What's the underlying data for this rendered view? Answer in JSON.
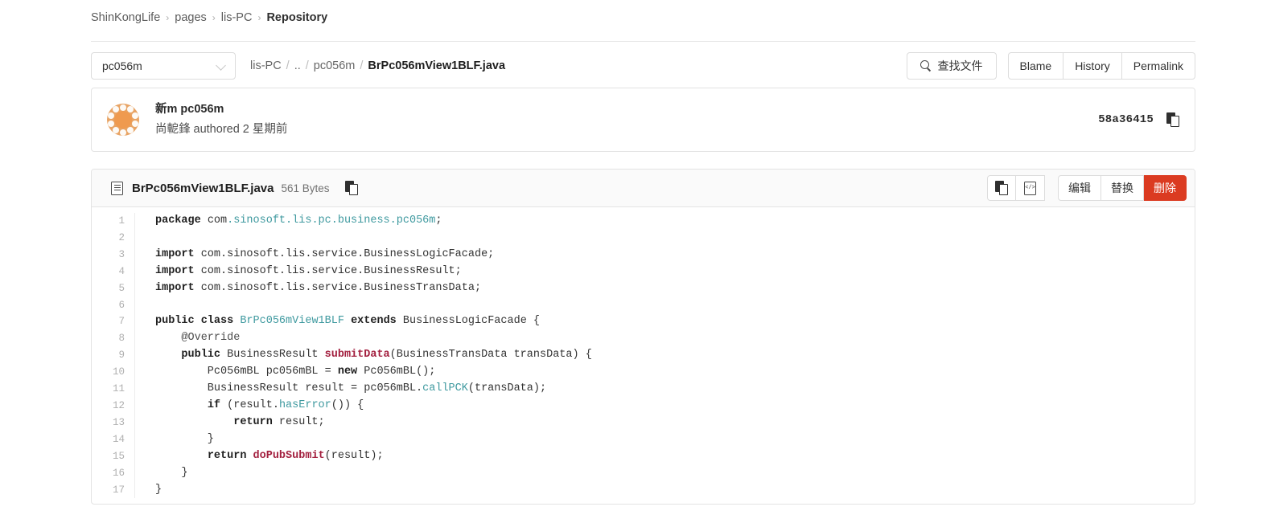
{
  "breadcrumb": {
    "items": [
      {
        "label": "ShinKongLife",
        "current": false
      },
      {
        "label": "pages",
        "current": false
      },
      {
        "label": "lis-PC",
        "current": false
      },
      {
        "label": "Repository",
        "current": true
      }
    ],
    "separator": "›"
  },
  "toolbar": {
    "branch_selected": "pc056m",
    "path": [
      {
        "label": "lis-PC",
        "type": "dir"
      },
      {
        "label": "..",
        "type": "dir"
      },
      {
        "label": "pc056m",
        "type": "dir"
      },
      {
        "label": "BrPc056mView1BLF.java",
        "type": "file"
      }
    ],
    "path_separator": "/",
    "find_file_label": "查找文件",
    "find_file_icon": "search-icon",
    "blame_label": "Blame",
    "history_label": "History",
    "permalink_label": "Permalink"
  },
  "commit": {
    "title": "新m pc056m",
    "meta": "尚軶鋒 authored 2 星期前",
    "sha": "58a36415",
    "copy_icon": "copy-icon",
    "avatar_icon": "avatar-identicon",
    "avatar_color": "#e8a465"
  },
  "file": {
    "icon": "document-icon",
    "name": "BrPc056mView1BLF.java",
    "size": "561 Bytes",
    "copy_icon": "copy-icon",
    "raw_icon": "open-raw-icon",
    "edit_label": "编辑",
    "replace_label": "替换",
    "delete_label": "删除",
    "delete_color": "#db3b21"
  },
  "code": {
    "line_numbers": [
      "1",
      "2",
      "3",
      "4",
      "5",
      "6",
      "7",
      "8",
      "9",
      "10",
      "11",
      "12",
      "13",
      "14",
      "15",
      "16",
      "17"
    ],
    "lines": [
      [
        {
          "t": "package",
          "c": "kw"
        },
        {
          "t": " com",
          "c": "pl"
        },
        {
          "t": ".sinosoft.lis.pc.business.pc056m",
          "c": "ns"
        },
        {
          "t": ";",
          "c": "pl"
        }
      ],
      [],
      [
        {
          "t": "import",
          "c": "kw"
        },
        {
          "t": " com.sinosoft.lis.service.BusinessLogicFacade;",
          "c": "pl"
        }
      ],
      [
        {
          "t": "import",
          "c": "kw"
        },
        {
          "t": " com.sinosoft.lis.service.BusinessResult;",
          "c": "pl"
        }
      ],
      [
        {
          "t": "import",
          "c": "kw"
        },
        {
          "t": " com.sinosoft.lis.service.BusinessTransData;",
          "c": "pl"
        }
      ],
      [],
      [
        {
          "t": "public class",
          "c": "kw"
        },
        {
          "t": " ",
          "c": "pl"
        },
        {
          "t": "BrPc056mView1BLF",
          "c": "typ"
        },
        {
          "t": " ",
          "c": "pl"
        },
        {
          "t": "extends",
          "c": "kw"
        },
        {
          "t": " BusinessLogicFacade {",
          "c": "pl"
        }
      ],
      [
        {
          "t": "    @Override",
          "c": "an"
        }
      ],
      [
        {
          "t": "    ",
          "c": "pl"
        },
        {
          "t": "public",
          "c": "kw"
        },
        {
          "t": " BusinessResult ",
          "c": "pl"
        },
        {
          "t": "submitData",
          "c": "fn"
        },
        {
          "t": "(BusinessTransData transData) {",
          "c": "pl"
        }
      ],
      [
        {
          "t": "        Pc056mBL pc056mBL = ",
          "c": "pl"
        },
        {
          "t": "new",
          "c": "kw"
        },
        {
          "t": " Pc056mBL();",
          "c": "pl"
        }
      ],
      [
        {
          "t": "        BusinessResult result = pc056mBL.",
          "c": "pl"
        },
        {
          "t": "callPCK",
          "c": "typ"
        },
        {
          "t": "(transData);",
          "c": "pl"
        }
      ],
      [
        {
          "t": "        ",
          "c": "pl"
        },
        {
          "t": "if",
          "c": "kw"
        },
        {
          "t": " (result.",
          "c": "pl"
        },
        {
          "t": "hasError",
          "c": "typ"
        },
        {
          "t": "()) {",
          "c": "pl"
        }
      ],
      [
        {
          "t": "            ",
          "c": "pl"
        },
        {
          "t": "return",
          "c": "kw"
        },
        {
          "t": " result;",
          "c": "pl"
        }
      ],
      [
        {
          "t": "        }",
          "c": "pl"
        }
      ],
      [
        {
          "t": "        ",
          "c": "pl"
        },
        {
          "t": "return",
          "c": "kw"
        },
        {
          "t": " ",
          "c": "pl"
        },
        {
          "t": "doPubSubmit",
          "c": "fn"
        },
        {
          "t": "(result);",
          "c": "pl"
        }
      ],
      [
        {
          "t": "    }",
          "c": "pl"
        }
      ],
      [
        {
          "t": "}",
          "c": "pl"
        }
      ]
    ]
  }
}
